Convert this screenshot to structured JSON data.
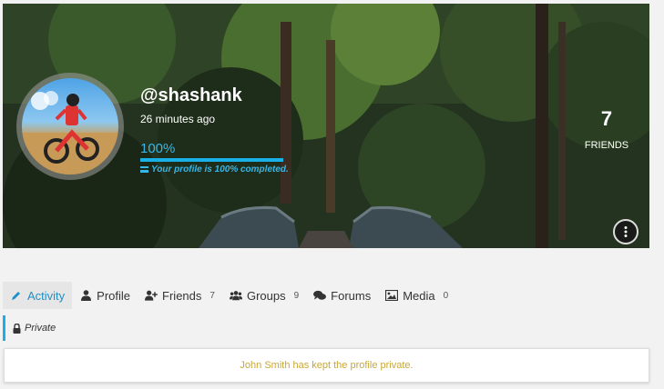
{
  "profile": {
    "username": "@shashank",
    "last_seen": "26 minutes ago",
    "completion_percent": "100%",
    "completion_fraction": 1.0,
    "completion_message": "Your profile is 100% completed.",
    "friends_count": "7",
    "friends_label": "FRIENDS",
    "more_icon": "ellipsis-vertical-icon"
  },
  "tabs": [
    {
      "label": "Activity",
      "icon": "pencil-icon",
      "count": ""
    },
    {
      "label": "Profile",
      "icon": "user-icon",
      "count": ""
    },
    {
      "label": "Friends",
      "icon": "user-plus-icon",
      "count": "7"
    },
    {
      "label": "Groups",
      "icon": "users-icon",
      "count": "9"
    },
    {
      "label": "Forums",
      "icon": "comments-icon",
      "count": ""
    },
    {
      "label": "Media",
      "icon": "image-icon",
      "count": "0"
    }
  ],
  "privacy": {
    "label": "Private",
    "icon": "lock-icon"
  },
  "notice": {
    "message": "John Smith has kept the profile private."
  },
  "colors": {
    "accent": "#19b0e8",
    "active_tab_text": "#1f8fc8",
    "notice_text": "#c8a83a"
  }
}
